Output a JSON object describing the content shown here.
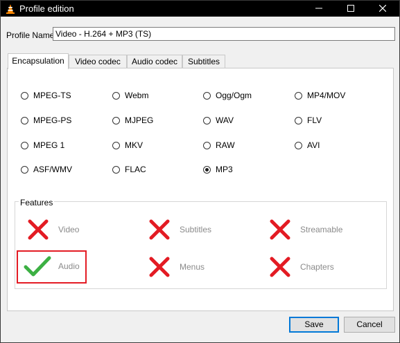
{
  "window": {
    "title": "Profile edition",
    "controls": {
      "minimize": "minimize",
      "maximize": "maximize",
      "close": "close"
    }
  },
  "profile": {
    "label": "Profile Name",
    "value": "Video - H.264 + MP3 (TS)"
  },
  "tabs": [
    {
      "label": "Encapsulation",
      "active": true
    },
    {
      "label": "Video codec",
      "active": false
    },
    {
      "label": "Audio codec",
      "active": false
    },
    {
      "label": "Subtitles",
      "active": false
    }
  ],
  "encapsulation": {
    "options": [
      {
        "label": "MPEG-TS",
        "checked": false
      },
      {
        "label": "Webm",
        "checked": false
      },
      {
        "label": "Ogg/Ogm",
        "checked": false
      },
      {
        "label": "MP4/MOV",
        "checked": false
      },
      {
        "label": "MPEG-PS",
        "checked": false
      },
      {
        "label": "MJPEG",
        "checked": false
      },
      {
        "label": "WAV",
        "checked": false
      },
      {
        "label": "FLV",
        "checked": false
      },
      {
        "label": "MPEG 1",
        "checked": false
      },
      {
        "label": "MKV",
        "checked": false
      },
      {
        "label": "RAW",
        "checked": false
      },
      {
        "label": "AVI",
        "checked": false
      },
      {
        "label": "ASF/WMV",
        "checked": false
      },
      {
        "label": "FLAC",
        "checked": false
      },
      {
        "label": "MP3",
        "checked": true
      }
    ]
  },
  "features": {
    "title": "Features",
    "items": [
      {
        "label": "Video",
        "supported": false
      },
      {
        "label": "Subtitles",
        "supported": false
      },
      {
        "label": "Streamable",
        "supported": false
      },
      {
        "label": "Audio",
        "supported": true
      },
      {
        "label": "Menus",
        "supported": false
      },
      {
        "label": "Chapters",
        "supported": false
      }
    ]
  },
  "buttons": {
    "save": "Save",
    "cancel": "Cancel"
  },
  "colors": {
    "cross": "#e31b23",
    "check": "#3cb043",
    "highlight": "#e31b23",
    "default_button_border": "#0078d7"
  }
}
